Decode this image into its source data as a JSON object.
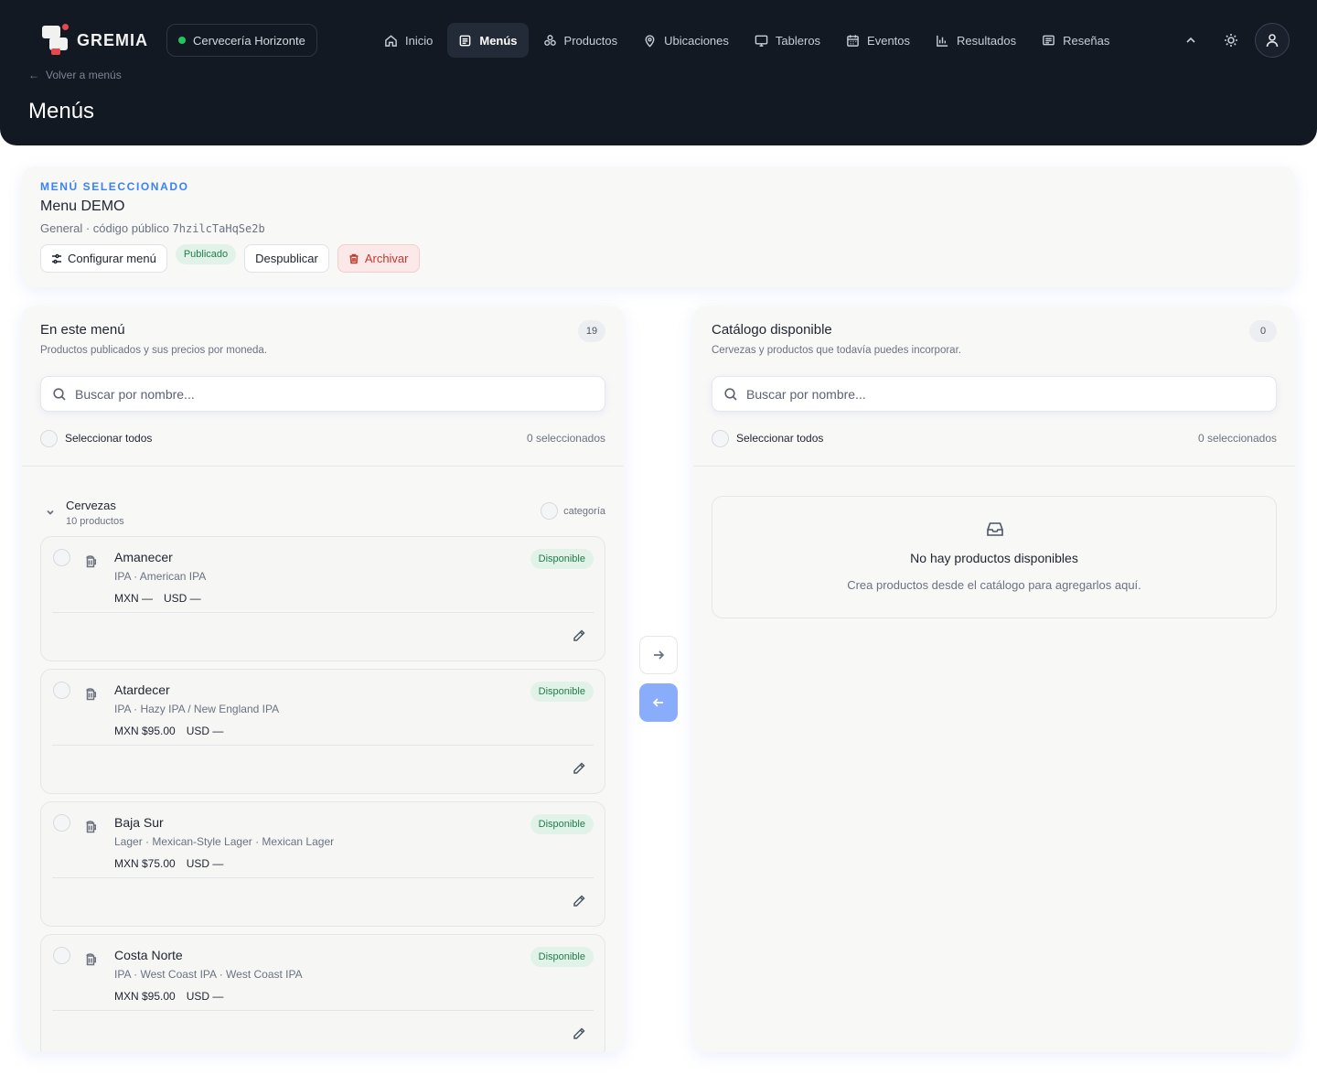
{
  "app": {
    "name": "GREMIA",
    "brewery": "Cervecería Horizonte"
  },
  "nav": [
    {
      "label": "Inicio",
      "icon": "home-icon"
    },
    {
      "label": "Menús",
      "icon": "menu-icon",
      "active": true
    },
    {
      "label": "Productos",
      "icon": "products-icon"
    },
    {
      "label": "Ubicaciones",
      "icon": "location-icon"
    },
    {
      "label": "Tableros",
      "icon": "monitor-icon"
    },
    {
      "label": "Eventos",
      "icon": "calendar-icon"
    },
    {
      "label": "Resultados",
      "icon": "bar-chart-icon"
    },
    {
      "label": "Reseñas",
      "icon": "review-icon"
    }
  ],
  "header": {
    "back": "Volver a menús",
    "title": "Menús"
  },
  "selected": {
    "eyebrow": "MENÚ SELECCIONADO",
    "name": "Menu DEMO",
    "sub_prefix": "General · código público",
    "code": "7hzilcTaHqSe2b",
    "configure": "Configurar menú",
    "status": "Publicado",
    "unpublish": "Despublicar",
    "archive": "Archivar"
  },
  "left": {
    "title": "En este menú",
    "desc": "Productos publicados y sus precios por moneda.",
    "count": "19",
    "search_placeholder": "Buscar por nombre...",
    "select_all": "Seleccionar todos",
    "selected_count": "0 seleccionados",
    "category": {
      "name": "Cervezas",
      "count": "10 productos",
      "toggle": "categoría"
    },
    "products": [
      {
        "name": "Amanecer",
        "style": "IPA · American IPA",
        "mxn": "MXN —",
        "usd": "USD —",
        "status": "Disponible"
      },
      {
        "name": "Atardecer",
        "style": "IPA · Hazy IPA / New England IPA",
        "mxn": "MXN $95.00",
        "usd": "USD —",
        "status": "Disponible"
      },
      {
        "name": "Baja Sur",
        "style": "Lager · Mexican-Style Lager · Mexican Lager",
        "mxn": "MXN $75.00",
        "usd": "USD —",
        "status": "Disponible"
      },
      {
        "name": "Costa Norte",
        "style": "IPA · West Coast IPA · West Coast IPA",
        "mxn": "MXN $95.00",
        "usd": "USD —",
        "status": "Disponible"
      }
    ]
  },
  "right": {
    "title": "Catálogo disponible",
    "desc": "Cervezas y productos que todavía puedes incorporar.",
    "count": "0",
    "search_placeholder": "Buscar por nombre...",
    "select_all": "Seleccionar todos",
    "selected_count": "0 seleccionados",
    "empty_title": "No hay productos disponibles",
    "empty_text": "Crea productos desde el catálogo para agregarlos aquí."
  },
  "colors": {
    "header_bg": "#131922",
    "accent": "#3b82f6",
    "success": "#237a4b",
    "danger": "#c0392b"
  }
}
